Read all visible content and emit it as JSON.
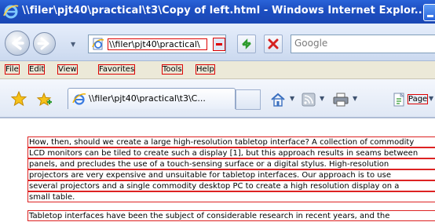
{
  "window": {
    "title": "\\\\filer\\pjt40\\practical\\t3\\Copy of left.html - Windows Internet Explor..."
  },
  "address_bar": {
    "url": "\\\\filer\\pjt40\\practical\\"
  },
  "search": {
    "placeholder": "Google"
  },
  "menu": {
    "items": [
      "File",
      "Edit",
      "View",
      "Favorites",
      "Tools",
      "Help"
    ]
  },
  "tab": {
    "title": "\\\\filer\\pjt40\\practical\\t3\\C..."
  },
  "command_bar": {
    "page_label": "Page"
  },
  "document": {
    "lines": [
      "How, then, should we create a large high-resolution tabletop interface? A collection of commodity",
      "LCD monitors can be tiled to create such a display [1], but this approach results in seams between",
      "panels, and precludes the use of a touch-sensing surface or a digital stylus. High-resolution",
      "projectors are very expensive and unsuitable for tabletop interfaces. Our approach is to use",
      "several projectors and a single commodity desktop PC to create a high resolution display on a",
      "small table.",
      "Tabletop interfaces have been the subject of considerable research in recent years, and the"
    ]
  },
  "colors": {
    "title_bar": "#1d4fc2",
    "highlight_border": "#dd2222"
  }
}
